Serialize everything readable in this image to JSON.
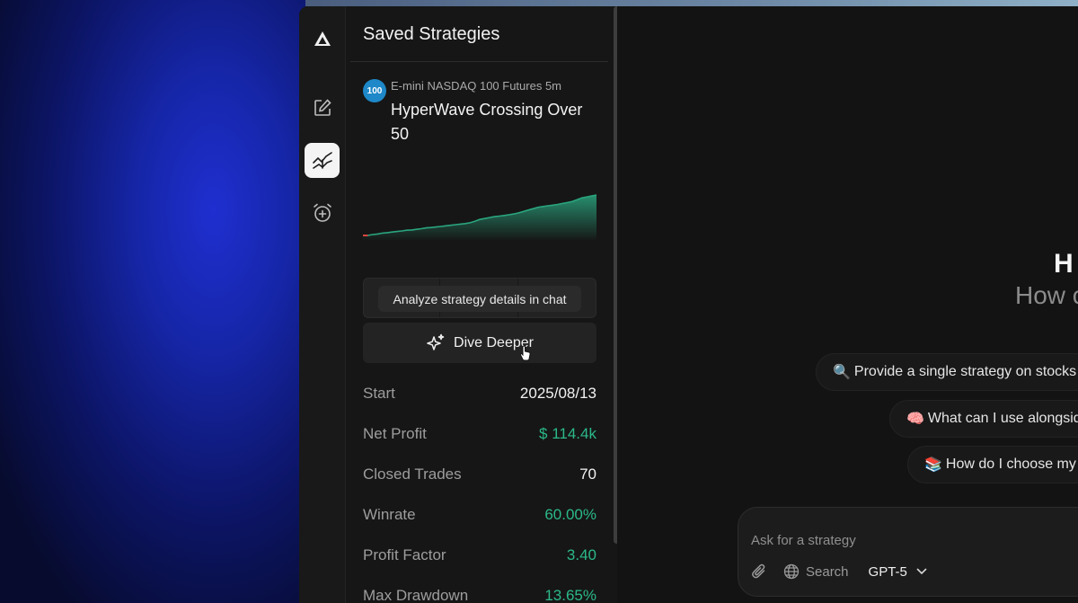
{
  "panel": {
    "title": "Saved Strategies"
  },
  "strategy": {
    "badge": "100",
    "instrument": "E-mini NASDAQ 100 Futures 5m",
    "name": "HyperWave Crossing Over 50",
    "tooltip": "Analyze strategy details in chat",
    "dive_label": "Dive Deeper",
    "stats": [
      {
        "label": "Start",
        "value": "2025/08/13",
        "accent": false
      },
      {
        "label": "Net Profit",
        "value": "$ 114.4k",
        "accent": true
      },
      {
        "label": "Closed Trades",
        "value": "70",
        "accent": false
      },
      {
        "label": "Winrate",
        "value": "60.00%",
        "accent": true
      },
      {
        "label": "Profit Factor",
        "value": "3.40",
        "accent": true
      },
      {
        "label": "Max Drawdown",
        "value": "13.65%",
        "accent": true
      }
    ]
  },
  "equity_curve": {
    "values": [
      0,
      0,
      1,
      1.5,
      2.5,
      3,
      3.6,
      4.2,
      4.8,
      5.5,
      5.8,
      6.5,
      7.2,
      8,
      8.4,
      9,
      9.6,
      10.2,
      10.8,
      11.5,
      12,
      12.6,
      13.5,
      15,
      17,
      18,
      19,
      20,
      20.5,
      21.2,
      22,
      22.8,
      24,
      25.5,
      27,
      28.5,
      30,
      30.8,
      31.5,
      32.2,
      33,
      34,
      35,
      36,
      38,
      40,
      41,
      42,
      43
    ],
    "drawdown_segment_color": "#d9443e",
    "line_color": "#2aa57e"
  },
  "main": {
    "greeting_title": "H",
    "greeting_sub": "How c",
    "suggestions": [
      {
        "emoji": "🔍",
        "text": "Provide a single strategy on stocks w"
      },
      {
        "emoji": "🧠",
        "text": "What can I use alongside"
      },
      {
        "emoji": "📚",
        "text": "How do I choose my s"
      }
    ],
    "composer": {
      "placeholder": "Ask for a strategy",
      "search_label": "Search",
      "model_label": "GPT-5"
    }
  },
  "colors": {
    "accent_green": "#2bb98a",
    "badge_blue": "#1e88c8"
  }
}
